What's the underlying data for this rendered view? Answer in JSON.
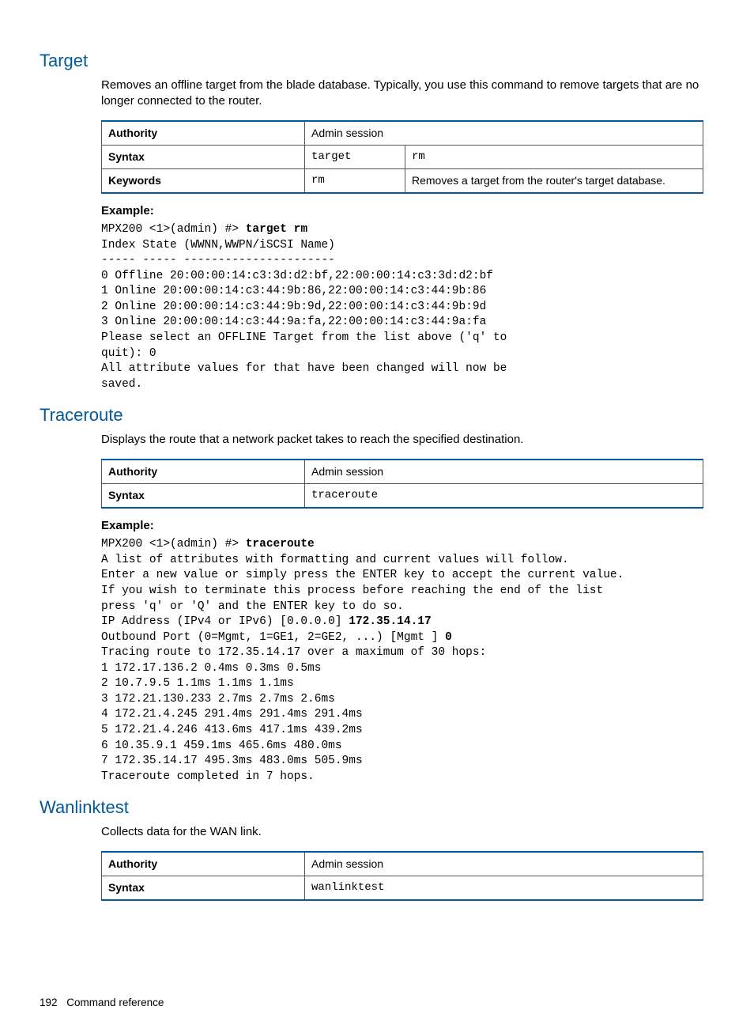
{
  "sections": {
    "target": {
      "title": "Target",
      "desc": "Removes an offline target from the blade database. Typically, you use this command to remove targets that are no longer connected to the router.",
      "table": {
        "authority_label": "Authority",
        "authority_value": "Admin session",
        "syntax_label": "Syntax",
        "syntax_cmd": "target",
        "syntax_arg": "rm",
        "keywords_label": "Keywords",
        "keywords_kw": "rm",
        "keywords_desc": "Removes a target from the router's target database."
      },
      "example_label": "Example:",
      "example_prompt": "MPX200 <1>(admin) #> ",
      "example_cmd": "target rm",
      "example_body": "Index State (WWNN,WWPN/iSCSI Name)\n----- ----- ----------------------\n0 Offline 20:00:00:14:c3:3d:d2:bf,22:00:00:14:c3:3d:d2:bf\n1 Online 20:00:00:14:c3:44:9b:86,22:00:00:14:c3:44:9b:86\n2 Online 20:00:00:14:c3:44:9b:9d,22:00:00:14:c3:44:9b:9d\n3 Online 20:00:00:14:c3:44:9a:fa,22:00:00:14:c3:44:9a:fa\nPlease select an OFFLINE Target from the list above ('q' to\nquit): 0\nAll attribute values for that have been changed will now be\nsaved."
    },
    "traceroute": {
      "title": "Traceroute",
      "desc": "Displays the route that a network packet takes to reach the specified destination.",
      "table": {
        "authority_label": "Authority",
        "authority_value": "Admin session",
        "syntax_label": "Syntax",
        "syntax_cmd": "traceroute"
      },
      "example_label": "Example:",
      "example_prompt": "MPX200 <1>(admin) #> ",
      "example_cmd": "traceroute",
      "example_line2": "A list of attributes with formatting and current values will follow.\nEnter a new value or simply press the ENTER key to accept the current value.\nIf you wish to terminate this process before reaching the end of the list\npress 'q' or 'Q' and the ENTER key to do so.",
      "example_ip_prompt": "IP Address (IPv4 or IPv6) [0.0.0.0] ",
      "example_ip_val": "172.35.14.17",
      "example_port_prompt": "Outbound Port (0=Mgmt, 1=GE1, 2=GE2, ...) [Mgmt ] ",
      "example_port_val": "0",
      "example_trace": "Tracing route to 172.35.14.17 over a maximum of 30 hops:\n1 172.17.136.2 0.4ms 0.3ms 0.5ms\n2 10.7.9.5 1.1ms 1.1ms 1.1ms\n3 172.21.130.233 2.7ms 2.7ms 2.6ms\n4 172.21.4.245 291.4ms 291.4ms 291.4ms\n5 172.21.4.246 413.6ms 417.1ms 439.2ms\n6 10.35.9.1 459.1ms 465.6ms 480.0ms\n7 172.35.14.17 495.3ms 483.0ms 505.9ms\nTraceroute completed in 7 hops."
    },
    "wanlinktest": {
      "title": "Wanlinktest",
      "desc": "Collects data for the WAN link.",
      "table": {
        "authority_label": "Authority",
        "authority_value": "Admin session",
        "syntax_label": "Syntax",
        "syntax_cmd": "wanlinktest"
      }
    }
  },
  "footer": {
    "page": "192",
    "title": "Command reference"
  }
}
